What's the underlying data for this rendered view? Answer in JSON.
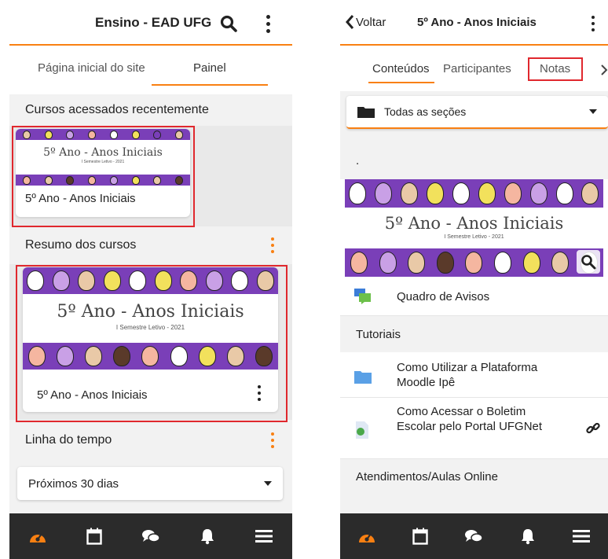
{
  "left": {
    "header": {
      "title": "Ensino - EAD UFG"
    },
    "tabs": [
      {
        "label": "Página inicial do site"
      },
      {
        "label": "Painel"
      }
    ],
    "recent": {
      "heading": "Cursos acessados recentemente",
      "card": {
        "banner_title": "5º Ano - Anos Iniciais",
        "banner_subtitle": "I Semestre Letivo - 2021",
        "name": "5º Ano - Anos Iniciais"
      }
    },
    "overview": {
      "heading": "Resumo dos cursos",
      "card": {
        "banner_title": "5º Ano - Anos Iniciais",
        "banner_subtitle": "I Semestre Letivo - 2021",
        "name": "5º Ano - Anos Iniciais"
      }
    },
    "timeline": {
      "heading": "Linha do tempo",
      "filter": "Próximos 30 dias"
    }
  },
  "right": {
    "header": {
      "back": "Voltar",
      "title": "5º Ano - Anos Iniciais"
    },
    "tabs": [
      {
        "label": "Conteúdos"
      },
      {
        "label": "Participantes"
      },
      {
        "label": "Notas"
      }
    ],
    "section_select": "Todas as seções",
    "dot_text": ".",
    "banner": {
      "title": "5º Ano - Anos Iniciais",
      "subtitle": "I Semestre Letivo - 2021"
    },
    "items": {
      "forum": "Quadro de Avisos",
      "tutorials_heading": "Tutoriais",
      "folder": "Como Utilizar a Plataforma Moodle Ipê",
      "url": "Como Acessar o Boletim Escolar pelo Portal UFGNet",
      "next_heading": "Atendimentos/Aulas Online"
    }
  },
  "colors": {
    "accent": "#f98012",
    "banner_purple": "#7a3fb8",
    "highlight_red": "#e0282e",
    "nav_bg": "#2b2b2b"
  },
  "icons": {
    "search": "search-icon",
    "more": "more-vertical-icon",
    "back": "chevron-left-icon",
    "dashboard": "dashboard-icon",
    "calendar": "calendar-icon",
    "messages": "messages-icon",
    "notifications": "bell-icon",
    "menu": "hamburger-menu-icon"
  }
}
